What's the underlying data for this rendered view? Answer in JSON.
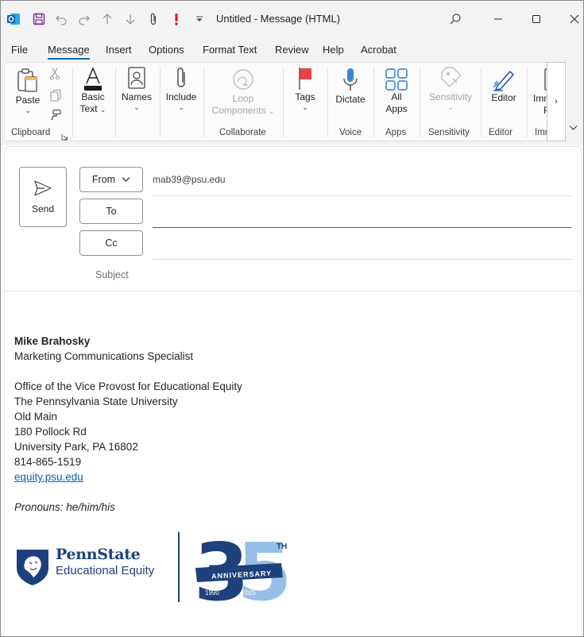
{
  "window": {
    "title": "Untitled  -  Message (HTML)"
  },
  "menu": {
    "tabs": [
      "File",
      "Message",
      "Insert",
      "Options",
      "Format Text",
      "Review",
      "Help",
      "Acrobat"
    ],
    "active": "Message"
  },
  "ribbon": {
    "paste": "Paste",
    "basic_text": [
      "Basic",
      "Text"
    ],
    "names": "Names",
    "include": "Include",
    "loop_components": [
      "Loop",
      "Components"
    ],
    "tags": "Tags",
    "dictate": "Dictate",
    "all_apps": [
      "All",
      "Apps"
    ],
    "sensitivity": "Sensitivity",
    "editor": "Editor",
    "immersive_reader": [
      "Imm",
      "R"
    ],
    "groups": {
      "clipboard": "Clipboard",
      "collaborate": "Collaborate",
      "voice": "Voice",
      "apps": "Apps",
      "sensitivity": "Sensitivity",
      "editor": "Editor",
      "immersive": "Imm"
    }
  },
  "compose": {
    "send_label": "Send",
    "from_label": "From",
    "from_address": "mab39@psu.edu",
    "to_label": "To",
    "cc_label": "Cc",
    "subject_label": "Subject"
  },
  "signature": {
    "name": "Mike Brahosky",
    "title": "Marketing Communications Specialist",
    "office": "Office of the Vice Provost for Educational Equity",
    "university": "The Pennsylvania State University",
    "building": "Old Main",
    "street": "180 Pollock Rd",
    "city": "University Park, PA 16802",
    "phone": "814-865-1519",
    "website": "equity.psu.edu",
    "pronouns": "Pronouns: he/him/his"
  },
  "logo": {
    "wordmark_line1": "PennState",
    "wordmark_line2": "Educational Equity",
    "anniversary_number": "35",
    "anniversary_suffix": "TH",
    "anniversary_banner": "ANNIVERSARY",
    "year_start": "1990",
    "year_end": "2025"
  },
  "colors": {
    "accent": "#0f6cbd",
    "penn_state_blue": "#1e407c",
    "light_blue": "#96bee6",
    "alert_red": "#e81123"
  }
}
